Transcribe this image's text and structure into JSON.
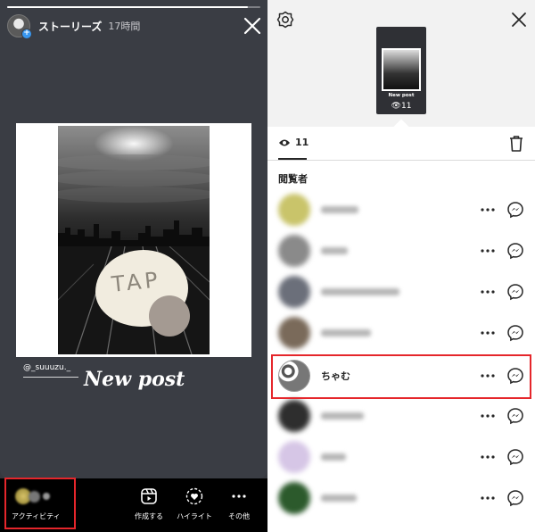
{
  "story": {
    "progress": 0.95,
    "username": "ストーリーズ",
    "time": "17時間",
    "mention": "@_suuuzu._",
    "caption": "New post",
    "sticker_text": "TAP"
  },
  "bottom_bar": {
    "activity_label": "アクティビティ",
    "create_label": "作成する",
    "highlight_label": "ハイライト",
    "more_label": "その他"
  },
  "viewers_panel": {
    "thumb_caption": "New post",
    "thumb_count": "11",
    "views_count": "11",
    "section_title": "閲覧者",
    "viewers": [
      {
        "name": "",
        "blurred": true,
        "avatar_color": "#c9c46a"
      },
      {
        "name": "",
        "blurred": true,
        "avatar_color": "#8a8a8a"
      },
      {
        "name": "",
        "blurred": true,
        "avatar_color": "#6b6f7a"
      },
      {
        "name": "",
        "blurred": true,
        "avatar_color": "#7a6a5a"
      },
      {
        "name": "ちゃむ",
        "blurred": false,
        "avatar_color": "#cfcfcf"
      },
      {
        "name": "",
        "blurred": true,
        "avatar_color": "#2e2e2e"
      },
      {
        "name": "",
        "blurred": true,
        "avatar_color": "#d6c6e6"
      },
      {
        "name": "",
        "blurred": true,
        "avatar_color": "#2c5a2c"
      }
    ]
  },
  "colors": {
    "highlight_border": "#e5262b",
    "story_bg": "#3a3d44",
    "panel_bg": "#f2f2f2"
  }
}
